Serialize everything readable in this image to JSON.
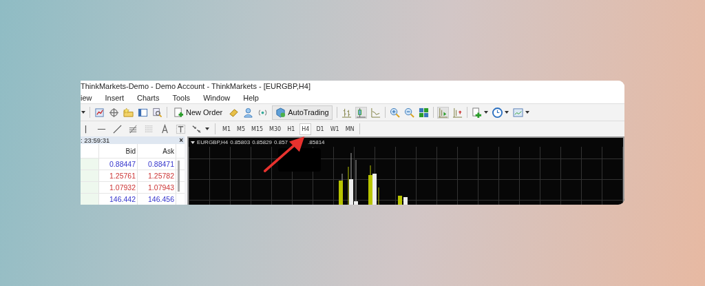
{
  "window": {
    "title": "ThinkMarkets-Demo - Demo Account - ThinkMarkets - [EURGBP,H4]"
  },
  "menu": [
    {
      "label": "iew"
    },
    {
      "label": "Insert"
    },
    {
      "label": "Charts"
    },
    {
      "label": "Tools"
    },
    {
      "label": "Window"
    },
    {
      "label": "Help"
    }
  ],
  "toolbar": {
    "new_order": "New Order",
    "auto_trading": "AutoTrading"
  },
  "timeframes": [
    {
      "label": "M1",
      "selected": false
    },
    {
      "label": "M5",
      "selected": false
    },
    {
      "label": "M15",
      "selected": false
    },
    {
      "label": "M30",
      "selected": false
    },
    {
      "label": "H1",
      "selected": false
    },
    {
      "label": "H4",
      "selected": true
    },
    {
      "label": "D1",
      "selected": false
    },
    {
      "label": "W1",
      "selected": false
    },
    {
      "label": "MN",
      "selected": false
    }
  ],
  "market_watch": {
    "time": ": 23:59:31",
    "close": "×",
    "columns": [
      "Bid",
      "Ask"
    ],
    "rows": [
      {
        "bid": "0.88447",
        "ask": "0.88471",
        "rising": true
      },
      {
        "bid": "1.25761",
        "ask": "1.25782",
        "rising": false
      },
      {
        "bid": "1.07932",
        "ask": "1.07943",
        "rising": false
      },
      {
        "bid": "146.442",
        "ask": "146.456",
        "rising": true
      }
    ]
  },
  "chart": {
    "symbol": "EURGBP,H4",
    "values": [
      "0.85803",
      "0.85829",
      "0.857",
      ".85814"
    ]
  }
}
